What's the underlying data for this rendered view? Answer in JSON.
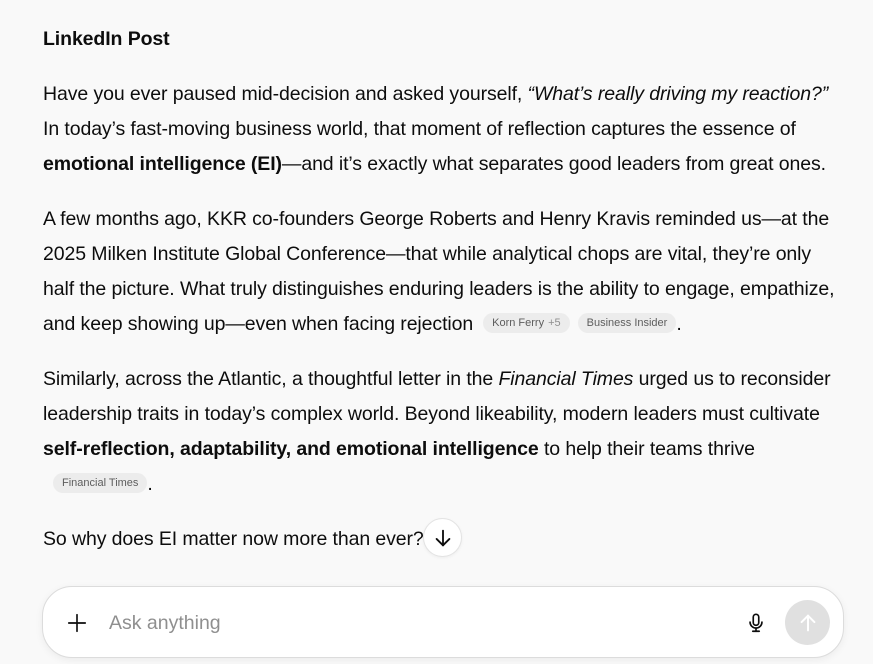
{
  "post": {
    "heading": "LinkedIn Post",
    "p1": {
      "t1": "Have you ever paused mid-decision and asked yourself, ",
      "quote": "“What’s really driving my reaction?”",
      "t2": " In today’s fast-moving business world, that moment of reflection captures the essence of ",
      "bold": "emotional intelligence (EI)",
      "t3": "—and it’s exactly what separates good leaders from great ones."
    },
    "p2": {
      "text": "A few months ago, KKR co-founders George Roberts and Henry Kravis reminded us—at the 2025 Milken Institute Global Conference—that while analytical chops are vital, they’re only half the picture. What truly distinguishes enduring leaders is the ability to engage, empathize, and keep showing up—even when facing rejection",
      "cite1": "Korn Ferry",
      "cite1_extra": "+5",
      "cite2": "Business Insider",
      "end": "."
    },
    "p3": {
      "t1": "Similarly, across the Atlantic, a thoughtful letter in the ",
      "italic": "Financial Times",
      "t2": " urged us to reconsider leadership traits in today’s complex world. Beyond likeability, modern leaders must cultivate ",
      "bold": "self-reflection, adaptability, and emotional intelligence",
      "t3": " to help their teams thrive",
      "cite": "Financial Times",
      "end": "."
    },
    "p4": "So why does EI matter now more than ever?"
  },
  "composer": {
    "placeholder": "Ask anything",
    "value": ""
  },
  "icons": {
    "scroll_down": "arrow-down-icon",
    "plus": "plus-icon",
    "mic": "microphone-icon",
    "send": "arrow-up-icon"
  }
}
